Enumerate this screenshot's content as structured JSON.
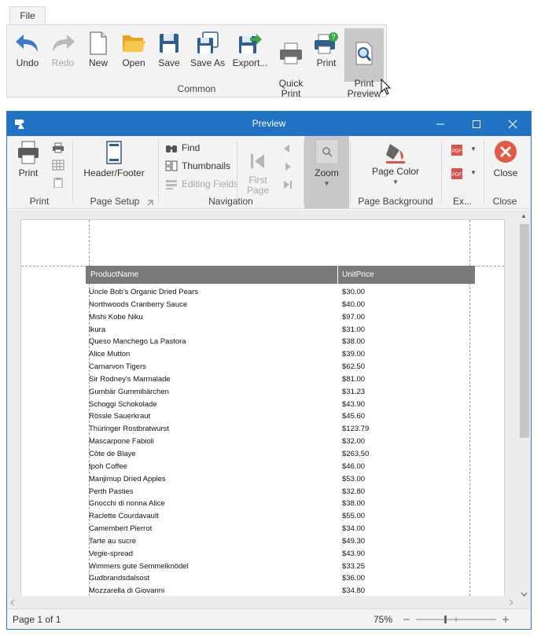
{
  "app_ribbon": {
    "file_tab": "File",
    "buttons": [
      {
        "label": "Undo"
      },
      {
        "label": "Redo"
      },
      {
        "label": "New"
      },
      {
        "label": "Open"
      },
      {
        "label": "Save"
      },
      {
        "label": "Save As"
      },
      {
        "label": "Export..."
      },
      {
        "label": "Quick\nPrint"
      },
      {
        "label": "Print"
      },
      {
        "label": "Print\nPreview"
      }
    ],
    "group_label": "Common"
  },
  "preview": {
    "title": "Preview",
    "ribbon": {
      "print_group": {
        "print_label": "Print",
        "group_label": "Print"
      },
      "page_setup": {
        "header_footer_label": "Header/Footer",
        "group_label": "Page Setup"
      },
      "navigation": {
        "find_label": "Find",
        "thumbnails_label": "Thumbnails",
        "editing_fields_label": "Editing Fields",
        "first_page_label": "First\nPage",
        "group_label": "Navigation"
      },
      "zoom": {
        "zoom_label": "Zoom"
      },
      "page_background": {
        "page_color_label": "Page Color",
        "group_label": "Page Background"
      },
      "export": {
        "group_label": "Ex..."
      },
      "close": {
        "close_label": "Close",
        "group_label": "Close"
      }
    },
    "table": {
      "headers": [
        "ProductName",
        "UnitPrice"
      ],
      "rows": [
        [
          "Uncle Bob's Organic Dried Pears",
          "$30.00"
        ],
        [
          "Northwoods Cranberry Sauce",
          "$40.00"
        ],
        [
          "Mishi Kobe Niku",
          "$97.00"
        ],
        [
          "Ikura",
          "$31.00"
        ],
        [
          "Queso Manchego La Pastora",
          "$38.00"
        ],
        [
          "Alice Mutton",
          "$39.00"
        ],
        [
          "Carnarvon Tigers",
          "$62.50"
        ],
        [
          "Sir Rodney's Marmalade",
          "$81.00"
        ],
        [
          "Gumbär Gummibärchen",
          "$31.23"
        ],
        [
          "Schoggi Schokolade",
          "$43.90"
        ],
        [
          "Rössle Sauerkraut",
          "$45.60"
        ],
        [
          "Thüringer Rostbratwurst",
          "$123.79"
        ],
        [
          "Mascarpone Fabioli",
          "$32.00"
        ],
        [
          "Côte de Blaye",
          "$263.50"
        ],
        [
          "Ipoh Coffee",
          "$46.00"
        ],
        [
          "Manjimup Dried Apples",
          "$53.00"
        ],
        [
          "Perth Pasties",
          "$32.80"
        ],
        [
          "Gnocchi di nonna Alice",
          "$38.00"
        ],
        [
          "Raclette Courdavault",
          "$55.00"
        ],
        [
          "Camembert Pierrot",
          "$34.00"
        ],
        [
          "Tarte au sucre",
          "$49.30"
        ],
        [
          "Vegie-spread",
          "$43.90"
        ],
        [
          "Wimmers gute Semmelknödel",
          "$33.25"
        ],
        [
          "Gudbrandsdalsost",
          "$36.00"
        ],
        [
          "Mozzarella di Giovanni",
          "$34.80"
        ]
      ]
    },
    "status": {
      "page_info": "Page 1 of 1",
      "zoom": "75%"
    }
  }
}
